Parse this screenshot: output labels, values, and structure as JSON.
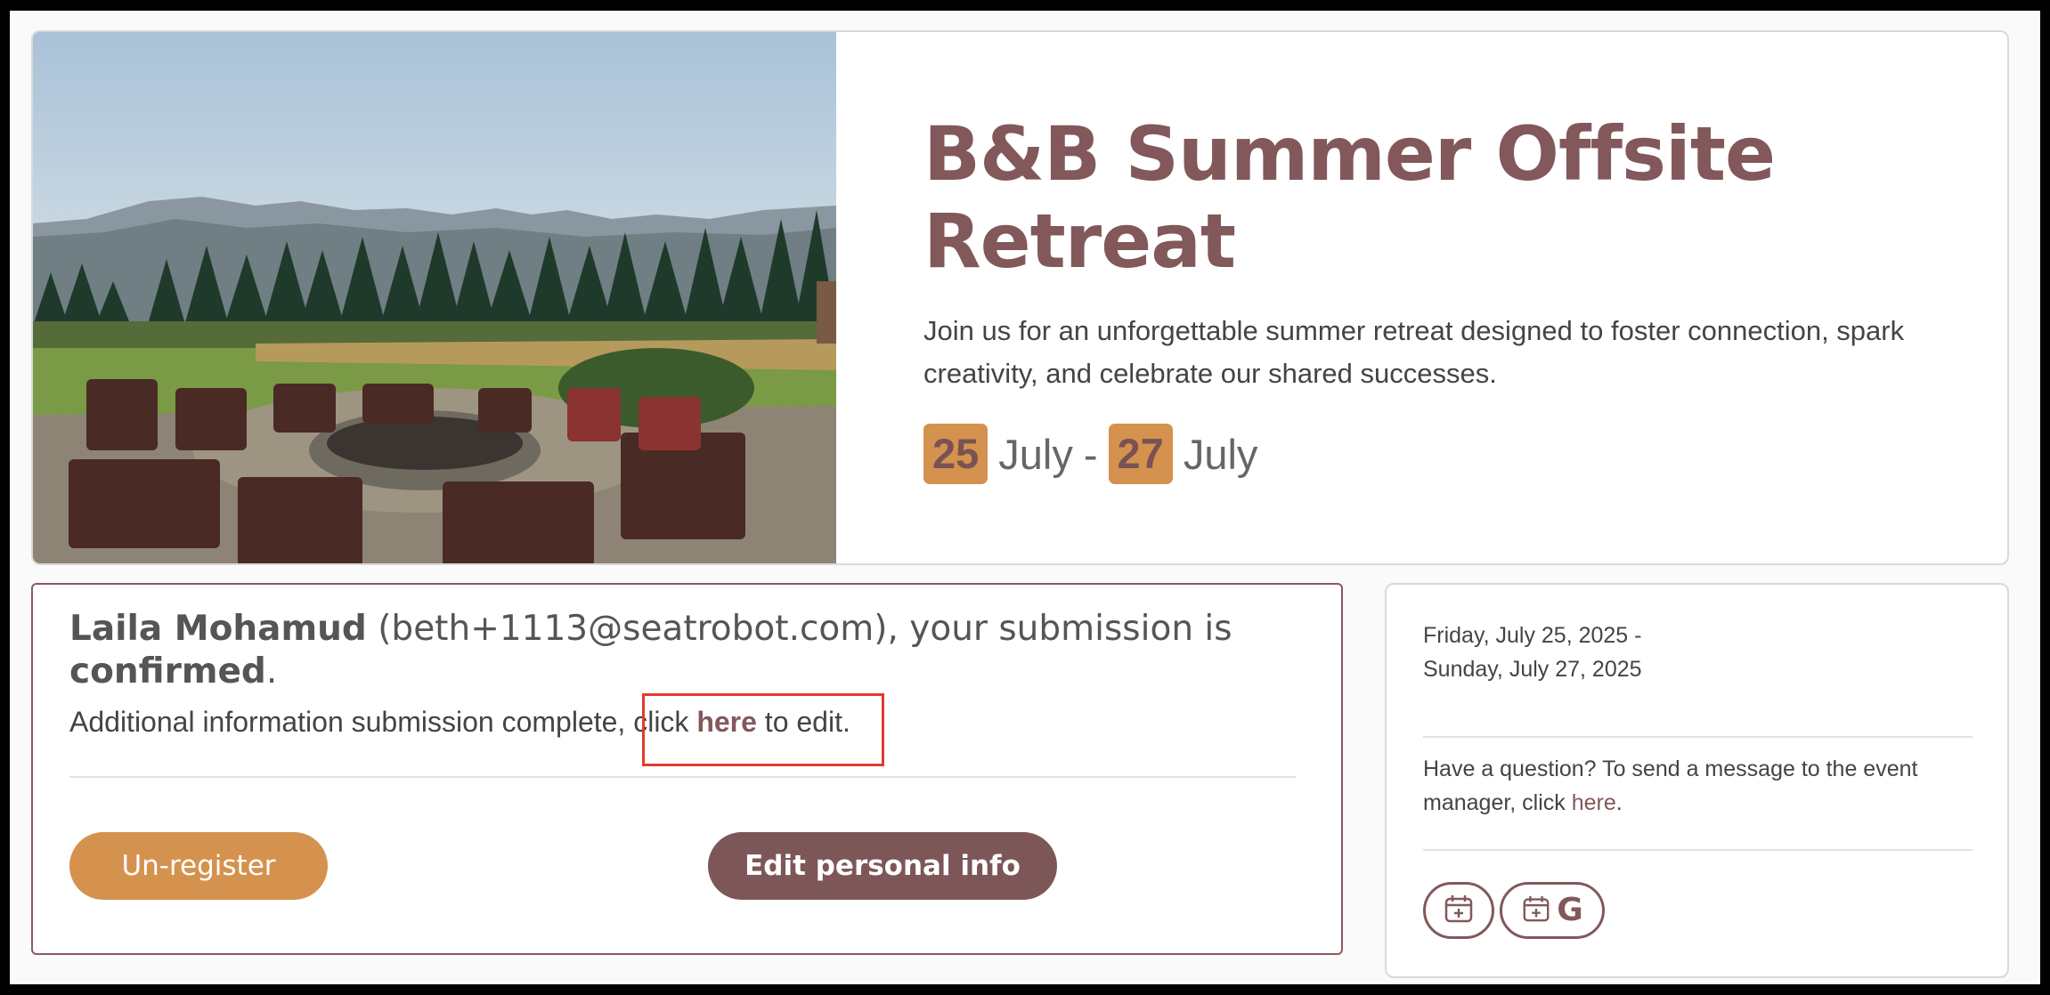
{
  "event": {
    "title": "B&B Summer Offsite Retreat",
    "description": "Join us for an unforgettable summer retreat designed to foster connection, spark creativity, and celebrate our shared successes.",
    "start_day": "25",
    "start_month": "July",
    "date_separator": "-",
    "end_day": "27",
    "end_month": "July"
  },
  "registration": {
    "attendee_name": "Laila Mohamud",
    "attendee_email": "(beth+1113@seatrobot.com)",
    "status_prefix": ", your submission is",
    "status_word": "confirmed",
    "status_suffix": ".",
    "info_text": "Additional information submission complete, click",
    "info_link": "here",
    "info_suffix": "to edit.",
    "unregister_label": "Un-register",
    "edit_label": "Edit personal info"
  },
  "sidebar": {
    "date_start": "Friday, July 25, 2025 -",
    "date_end": "Sunday, July 27, 2025",
    "question_text": "Have a question? To send a message to the event manager, click",
    "question_link": "here",
    "question_suffix": ".",
    "calendar_icon": "calendar-plus-icon",
    "google_calendar_icon": "google-calendar-icon",
    "google_letter": "G"
  },
  "colors": {
    "brand": "#82585b",
    "accent": "#d4924e",
    "highlight": "#e43b2c"
  }
}
